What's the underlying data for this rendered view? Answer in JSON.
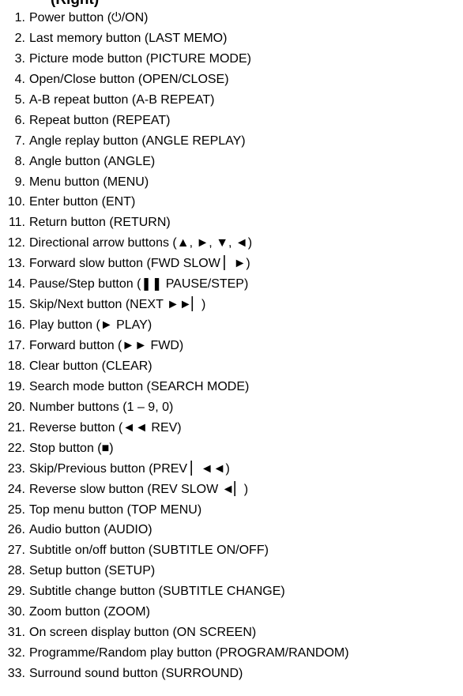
{
  "heading_fragment": "(Right)",
  "items": [
    {
      "num": "1.",
      "text": "Power button (⏻/ON)"
    },
    {
      "num": "2.",
      "text": "Last memory button (LAST MEMO)"
    },
    {
      "num": "3.",
      "text": "Picture mode button (PICTURE MODE)"
    },
    {
      "num": "4.",
      "text": "Open/Close button (OPEN/CLOSE)"
    },
    {
      "num": "5.",
      "text": "A-B repeat button (A-B REPEAT)"
    },
    {
      "num": "6.",
      "text": "Repeat button (REPEAT)"
    },
    {
      "num": "7.",
      "text": "Angle replay button (ANGLE REPLAY)"
    },
    {
      "num": "8.",
      "text": "Angle button (ANGLE)"
    },
    {
      "num": "9.",
      "text": "Menu button (MENU)"
    },
    {
      "num": "10.",
      "text": "Enter button (ENT)"
    },
    {
      "num": "11.",
      "text": "Return button (RETURN)"
    },
    {
      "num": "12.",
      "text": "Directional arrow buttons (▲, ►, ▼, ◄)"
    },
    {
      "num": "13.",
      "text": "Forward slow button (FWD SLOW ▏►)"
    },
    {
      "num": "14.",
      "text": "Pause/Step button (❚❚ PAUSE/STEP)"
    },
    {
      "num": "15.",
      "text": "Skip/Next button (NEXT ►►▏)"
    },
    {
      "num": "16.",
      "text": "Play button (► PLAY)"
    },
    {
      "num": "17.",
      "text": "Forward button (►► FWD)"
    },
    {
      "num": "18.",
      "text": "Clear button (CLEAR)"
    },
    {
      "num": "19.",
      "text": "Search mode button (SEARCH MODE)"
    },
    {
      "num": "20.",
      "text": "Number buttons (1 – 9, 0)"
    },
    {
      "num": "21.",
      "text": "Reverse button (◄◄ REV)"
    },
    {
      "num": "22.",
      "text": "Stop button (■)"
    },
    {
      "num": "23.",
      "text": "Skip/Previous button (PREV ▏◄◄)"
    },
    {
      "num": "24.",
      "text": "Reverse slow button (REV SLOW ◄▏)"
    },
    {
      "num": "25.",
      "text": "Top menu button (TOP MENU)"
    },
    {
      "num": "26.",
      "text": "Audio button (AUDIO)"
    },
    {
      "num": "27.",
      "text": "Subtitle on/off button (SUBTITLE ON/OFF)"
    },
    {
      "num": "28.",
      "text": "Setup button (SETUP)"
    },
    {
      "num": "29.",
      "text": "Subtitle change button (SUBTITLE CHANGE)"
    },
    {
      "num": "30.",
      "text": "Zoom button (ZOOM)"
    },
    {
      "num": "31.",
      "text": "On screen display button (ON SCREEN)"
    },
    {
      "num": "32.",
      "text": "Programme/Random play button (PROGRAM/RANDOM)"
    },
    {
      "num": "33.",
      "text": "Surround sound button (SURROUND)"
    }
  ]
}
